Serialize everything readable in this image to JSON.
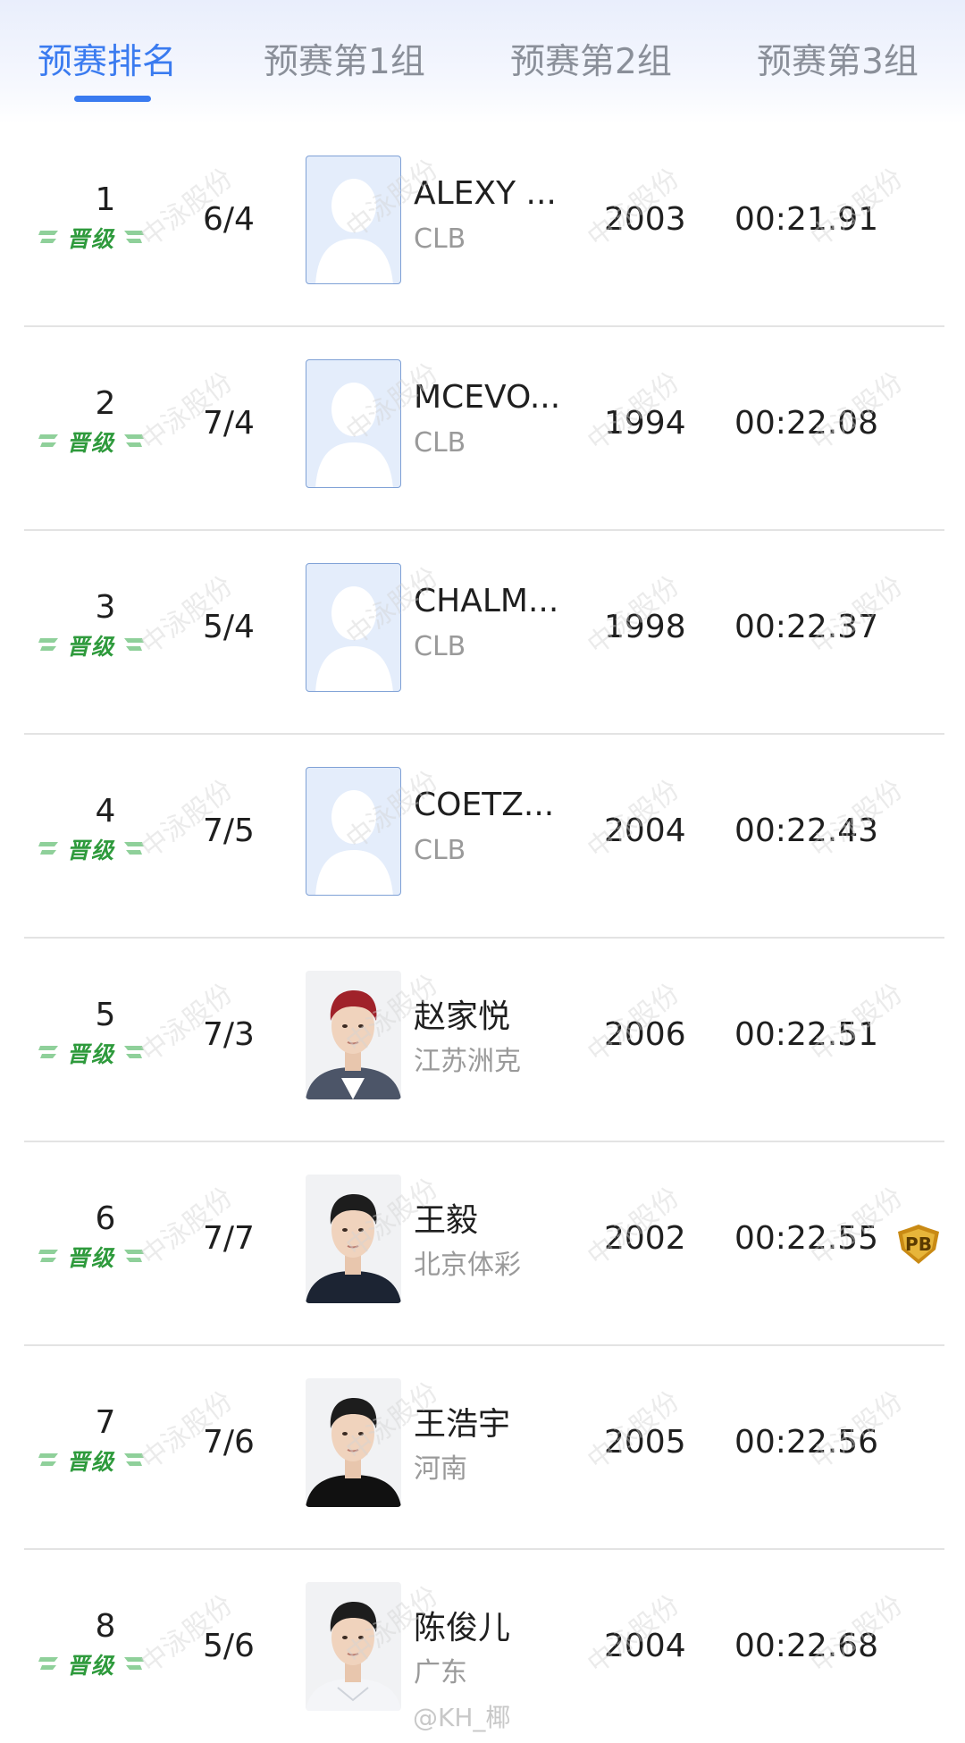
{
  "tabs": [
    {
      "label": "预赛排名",
      "active": true
    },
    {
      "label": "预赛第1组",
      "active": false
    },
    {
      "label": "预赛第2组",
      "active": false
    },
    {
      "label": "预赛第3组",
      "active": false
    }
  ],
  "badge_label": "晋级",
  "watermark": "中泳股份",
  "footer_watermark": "@KH_椰",
  "colors": {
    "accent": "#3a7bf0",
    "qualified": "#2e9a3c",
    "placeholder": "#e4edfb"
  },
  "rows": [
    {
      "rank": "1",
      "lane": "6/4",
      "name": "ALEXY ...",
      "team": "CLB",
      "year": "2003",
      "time": "00:21.91",
      "photo": "placeholder",
      "pb": false
    },
    {
      "rank": "2",
      "lane": "7/4",
      "name": "MCEVO...",
      "team": "CLB",
      "year": "1994",
      "time": "00:22.08",
      "photo": "placeholder",
      "pb": false
    },
    {
      "rank": "3",
      "lane": "5/4",
      "name": "CHALM...",
      "team": "CLB",
      "year": "1998",
      "time": "00:22.37",
      "photo": "placeholder",
      "pb": false
    },
    {
      "rank": "4",
      "lane": "7/5",
      "name": "COETZ...",
      "team": "CLB",
      "year": "2004",
      "time": "00:22.43",
      "photo": "placeholder",
      "pb": false
    },
    {
      "rank": "5",
      "lane": "7/3",
      "name": "赵家悦",
      "team": "江苏洲克",
      "year": "2006",
      "time": "00:22.51",
      "photo": "portrait-red-hair",
      "pb": false
    },
    {
      "rank": "6",
      "lane": "7/7",
      "name": "王毅",
      "team": "北京体彩",
      "year": "2002",
      "time": "00:22.55",
      "photo": "portrait-dark-shirt",
      "pb": true,
      "pb_label": "PB"
    },
    {
      "rank": "7",
      "lane": "7/6",
      "name": "王浩宇",
      "team": "河南",
      "year": "2005",
      "time": "00:22.56",
      "photo": "portrait-black-shirt",
      "pb": false
    },
    {
      "rank": "8",
      "lane": "5/6",
      "name": "陈俊儿",
      "team": "广东",
      "year": "2004",
      "time": "00:22.68",
      "photo": "portrait-white-shirt",
      "pb": false
    }
  ]
}
